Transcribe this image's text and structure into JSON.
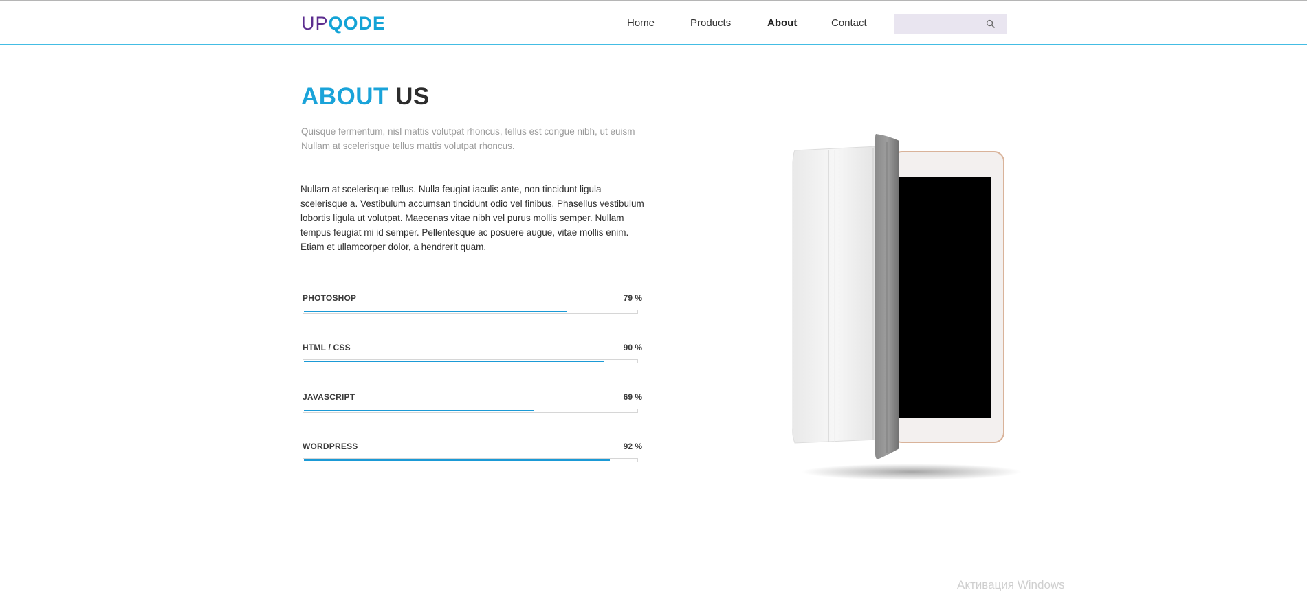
{
  "header": {
    "logo": {
      "part1": "UP",
      "part2": "QODE"
    },
    "nav": [
      {
        "label": "Home",
        "active": false
      },
      {
        "label": "Products",
        "active": false
      },
      {
        "label": "About",
        "active": true
      },
      {
        "label": "Contact",
        "active": false
      }
    ],
    "search": {
      "placeholder": "",
      "icon": "search-icon"
    }
  },
  "about": {
    "title_part1": "ABOUT",
    "title_part2": "US",
    "lead_line1": "Quisque fermentum, nisl mattis volutpat rhoncus, tellus est congue nibh, ut euism",
    "lead_line2": "Nullam at scelerisque tellus mattis volutpat rhoncus.",
    "body_lines": [
      "Nullam at scelerisque tellus. Nulla feugiat iaculis ante, non tincidunt ligula",
      "scelerisque a. Vestibulum accumsan tincidunt odio vel finibus. Phasellus vestibulum",
      "lobortis ligula ut volutpat. Maecenas vitae nibh vel purus mollis semper. Nullam",
      "tempus feugiat mi id semper. Pellentesque ac posuere augue, vitae mollis enim.",
      "Etiam et ullamcorper dolor, a hendrerit quam."
    ]
  },
  "skills": [
    {
      "name": "PHOTOSHOP",
      "percent_label": "79 %",
      "value": 79
    },
    {
      "name": "HTML / CSS",
      "percent_label": "90 %",
      "value": 90
    },
    {
      "name": "JAVASCRIPT",
      "percent_label": "69 %",
      "value": 69
    },
    {
      "name": "WORDPRESS",
      "percent_label": "92 %",
      "value": 92
    }
  ],
  "colors": {
    "accent": "#1aa3d9",
    "logo_up": "#5c2d8f",
    "progress": "#1b9ad6",
    "header_border": "#44bde4"
  },
  "watermark": "Активация Windows"
}
